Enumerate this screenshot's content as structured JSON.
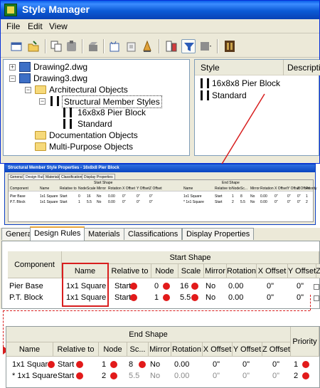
{
  "window": {
    "title": "Style Manager"
  },
  "menu": [
    "File",
    "Edit",
    "View"
  ],
  "toolbar": {
    "buttons": [
      "new-icon",
      "open-icon",
      "copy-icon",
      "paste-icon",
      "purge-icon",
      "edit-style-icon",
      "set-from-icon",
      "toggle-icon",
      "view-icon",
      "filter-icon",
      "display-icon",
      "exit-icon"
    ]
  },
  "tree": {
    "drawing2": "Drawing2.dwg",
    "drawing3": "Drawing3.dwg",
    "architectural": "Architectural Objects",
    "structural_member_styles": "Structural Member Styles",
    "style1": "16x8x8 Pier Block",
    "style2": "Standard",
    "documentation": "Documentation Objects",
    "multipurpose": "Multi-Purpose Objects"
  },
  "list": {
    "col_style": "Style",
    "col_description": "Descriptio",
    "rows": [
      "16x8x8 Pier Block",
      "Standard"
    ]
  },
  "thumbnail": {
    "title": "Structural Member Style Properties - 16x8x8 Pier Block",
    "tabs": [
      "General",
      "Design Rules",
      "Materials",
      "Classifications",
      "Display Properties"
    ],
    "start_shape": "Start Shape",
    "end_shape": "End Shape",
    "headers": [
      "Component",
      "Name",
      "Relative to",
      "Node",
      "Scale",
      "Mirror",
      "Rotation",
      "X Offset",
      "Y Offset",
      "Z Offset",
      "Name",
      "Relative to",
      "Node",
      "Sc...",
      "Mirror",
      "Rotation",
      "X Offset",
      "Y Offset",
      "Z Offset",
      "Priority"
    ],
    "row1": [
      "Pier Base",
      "1x1 Square",
      "Start",
      "0",
      "16",
      "No",
      "0.00",
      "0\"",
      "0\"",
      "0\"",
      "1x1 Square",
      "Start",
      "1",
      "8",
      "No",
      "0.00",
      "0\"",
      "0\"",
      "0\"",
      "1"
    ],
    "row2": [
      "P.T. Block",
      "1x1 Square",
      "Start",
      "1",
      "5.5",
      "No",
      "0.00",
      "0\"",
      "0\"",
      "0\"",
      "* 1x1 Square",
      "Start",
      "2",
      "5.5",
      "No",
      "0.00",
      "0\"",
      "0\"",
      "0\"",
      "2"
    ]
  },
  "design_rules": {
    "tabs": [
      "General",
      "Design Rules",
      "Materials",
      "Classifications",
      "Display Properties"
    ],
    "active_tab": "Design Rules",
    "start_shape": "Start Shape",
    "headers": {
      "component": "Component",
      "name": "Name",
      "relative_to": "Relative to",
      "node": "Node",
      "scale": "Scale",
      "mirror": "Mirror",
      "rotation": "Rotation",
      "x_offset": "X Offset",
      "y_offset": "Y Offset",
      "z_offset": "Z"
    },
    "rows": [
      {
        "component": "Pier Base",
        "name": "1x1 Square",
        "relative_to": "Start",
        "node": "0",
        "scale": "16",
        "mirror": "No",
        "rotation": "0.00",
        "x_offset": "0\"",
        "y_offset": "0\""
      },
      {
        "component": "P.T. Block",
        "name": "1x1 Square",
        "relative_to": "Start",
        "node": "1",
        "scale": "5.5",
        "mirror": "No",
        "rotation": "0.00",
        "x_offset": "0\"",
        "y_offset": "0\""
      }
    ]
  },
  "end_shape": {
    "title": "End Shape",
    "headers": {
      "name": "Name",
      "relative_to": "Relative to",
      "node": "Node",
      "scale": "Sc...",
      "mirror": "Mirror",
      "rotation": "Rotation",
      "x_offset": "X Offset",
      "y_offset": "Y Offset",
      "z_offset": "Z Offset",
      "priority": "Priority"
    },
    "rows": [
      {
        "name": "1x1 Square",
        "relative_to": "Start",
        "node": "1",
        "scale": "8",
        "mirror": "No",
        "rotation": "0.00",
        "x_offset": "0\"",
        "y_offset": "0\"",
        "z_offset": "0\"",
        "priority": "1"
      },
      {
        "name": "* 1x1 Square",
        "relative_to": "Start",
        "node": "2",
        "scale": "5.5",
        "mirror": "No",
        "rotation": "0.00",
        "x_offset": "0\"",
        "y_offset": "0\"",
        "z_offset": "0\"",
        "priority": "2"
      }
    ]
  },
  "colors": {
    "accent": "#0a5ee8",
    "highlight": "#d81e1e",
    "panel": "#ece9d8"
  }
}
